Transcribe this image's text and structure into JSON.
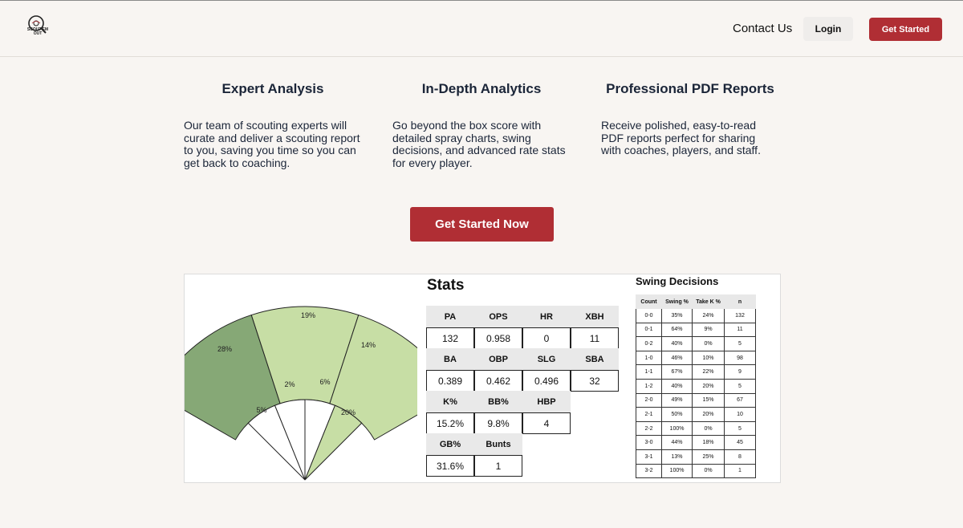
{
  "header": {
    "logo_text_1": "SCOUT'EM",
    "logo_text_2": "OUT",
    "nav": {
      "contact": "Contact Us",
      "login": "Login",
      "get_started": "Get Started"
    }
  },
  "features": [
    {
      "title": "Expert Analysis",
      "text": "Our team of scouting experts will curate and deliver a scouting report to you, saving you time so you can get back to coaching."
    },
    {
      "title": "In-Depth Analytics",
      "text": "Go beyond the box score with detailed spray charts, swing decisions, and advanced rate stats for every player."
    },
    {
      "title": "Professional PDF Reports",
      "text": "Receive polished, easy-to-read PDF reports perfect for sharing with coaches, players, and staff."
    }
  ],
  "cta": "Get Started Now",
  "spray_chart": {
    "outfield": [
      {
        "label": "28%",
        "value": 28,
        "color": "#86a876"
      },
      {
        "label": "19%",
        "value": 19,
        "color": "#c7dea5"
      },
      {
        "label": "14%",
        "value": 14,
        "color": "#c7dea5"
      }
    ],
    "infield": [
      {
        "label": "5%",
        "value": 5,
        "color": "#ffffff"
      },
      {
        "label": "2%",
        "value": 2,
        "color": "#ffffff"
      },
      {
        "label": "6%",
        "value": 6,
        "color": "#ffffff"
      },
      {
        "label": "20%",
        "value": 20,
        "color": "#c7dea5"
      }
    ]
  },
  "stats": {
    "title": "Stats",
    "rows": [
      {
        "headers": [
          "PA",
          "OPS",
          "HR",
          "XBH"
        ],
        "values": [
          "132",
          "0.958",
          "0",
          "11"
        ]
      },
      {
        "headers": [
          "BA",
          "OBP",
          "SLG",
          "SBA"
        ],
        "values": [
          "0.389",
          "0.462",
          "0.496",
          "32"
        ]
      },
      {
        "headers": [
          "K%",
          "BB%",
          "HBP"
        ],
        "values": [
          "15.2%",
          "9.8%",
          "4"
        ]
      },
      {
        "headers": [
          "GB%",
          "Bunts"
        ],
        "values": [
          "31.6%",
          "1"
        ]
      }
    ]
  },
  "swing_decisions": {
    "title": "Swing Decisions",
    "columns": [
      "Count",
      "Swing %",
      "Take K %",
      "n"
    ],
    "rows": [
      [
        "0-0",
        "35%",
        "24%",
        "132"
      ],
      [
        "0-1",
        "64%",
        "9%",
        "11"
      ],
      [
        "0-2",
        "40%",
        "0%",
        "5"
      ],
      [
        "1-0",
        "46%",
        "10%",
        "98"
      ],
      [
        "1-1",
        "67%",
        "22%",
        "9"
      ],
      [
        "1-2",
        "40%",
        "20%",
        "5"
      ],
      [
        "2-0",
        "49%",
        "15%",
        "67"
      ],
      [
        "2-1",
        "50%",
        "20%",
        "10"
      ],
      [
        "2-2",
        "100%",
        "0%",
        "5"
      ],
      [
        "3-0",
        "44%",
        "18%",
        "45"
      ],
      [
        "3-1",
        "13%",
        "25%",
        "8"
      ],
      [
        "3-2",
        "100%",
        "0%",
        "1"
      ]
    ]
  },
  "colors": {
    "accent": "#b02e34",
    "background": "#f8f5f2",
    "text": "#1b2538"
  }
}
